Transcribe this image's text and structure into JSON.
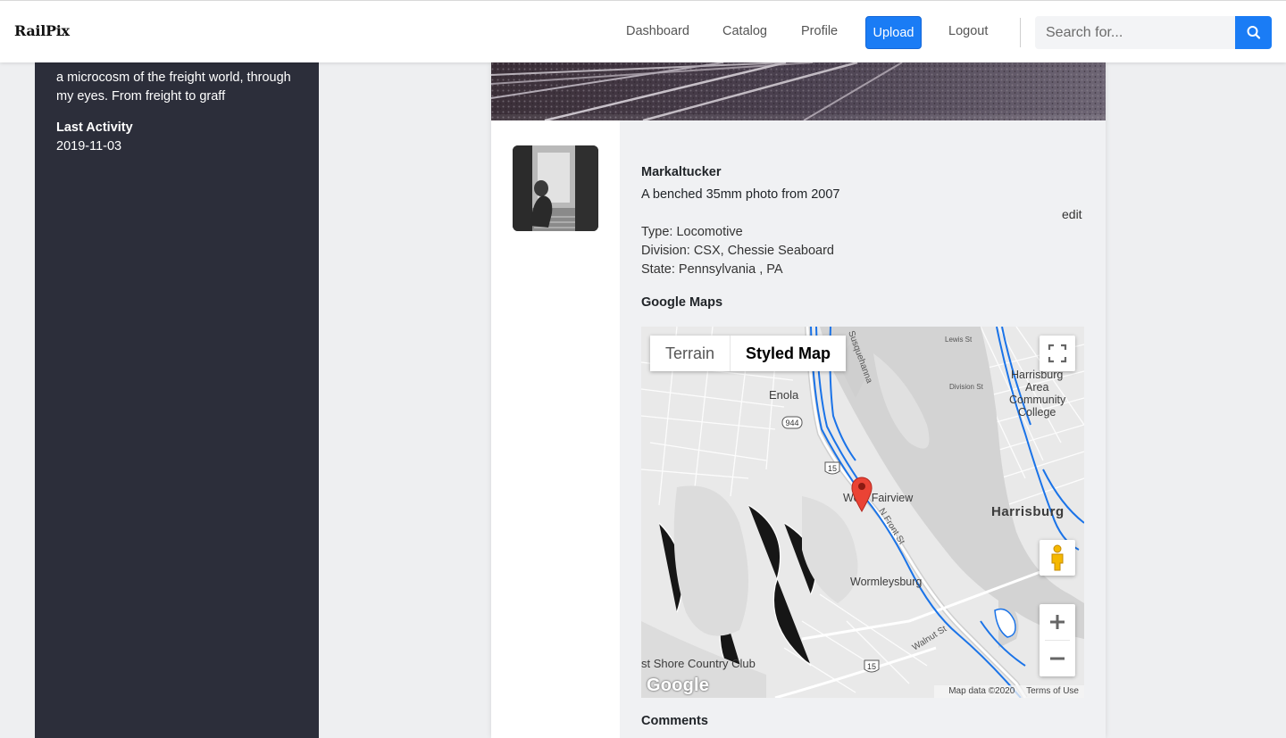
{
  "navbar": {
    "brand": "RailPix",
    "links": [
      "Dashboard",
      "Catalog",
      "Profile"
    ],
    "upload": "Upload",
    "logout": "Logout",
    "search_placeholder": "Search for..."
  },
  "sidebar": {
    "bio": "a microcosm of the freight world, through my eyes. From freight to graff",
    "last_activity_label": "Last Activity",
    "last_activity_value": "2019-11-03"
  },
  "photo": {
    "author": "Markaltucker",
    "caption": "A benched 35mm photo from 2007",
    "edit": "edit",
    "type": "Type: Locomotive",
    "division": "Division: CSX, Chessie Seaboard",
    "state": "State: Pennsylvania , PA"
  },
  "map": {
    "section_title": "Google Maps",
    "type_terrain": "Terrain",
    "type_styled": "Styled Map",
    "attribution": "Map data ©2020",
    "terms": "Terms of Use",
    "logo": "Google",
    "labels": {
      "enola": "Enola",
      "west_fairview": "West Fairview",
      "harrisburg": "Harrisburg",
      "wormleysburg": "Wormleysburg",
      "hacc_1": "Harrisburg",
      "hacc_2": "Area",
      "hacc_3": "Community",
      "hacc_4": "College",
      "country_club": "st Shore Country Club",
      "n_front_st": "N Front St",
      "walnut_st": "Walnut St",
      "susquehanna": "Susquehanna",
      "lewis_st": "Lewis St",
      "division_st": "Division St",
      "rt_944": "944",
      "rt_15a": "15",
      "rt_15b": "15"
    }
  },
  "comments_title": "Comments",
  "colors": {
    "accent": "#1a7cf5",
    "sidebar": "#2c2e3a",
    "marker": "#ea4335"
  }
}
